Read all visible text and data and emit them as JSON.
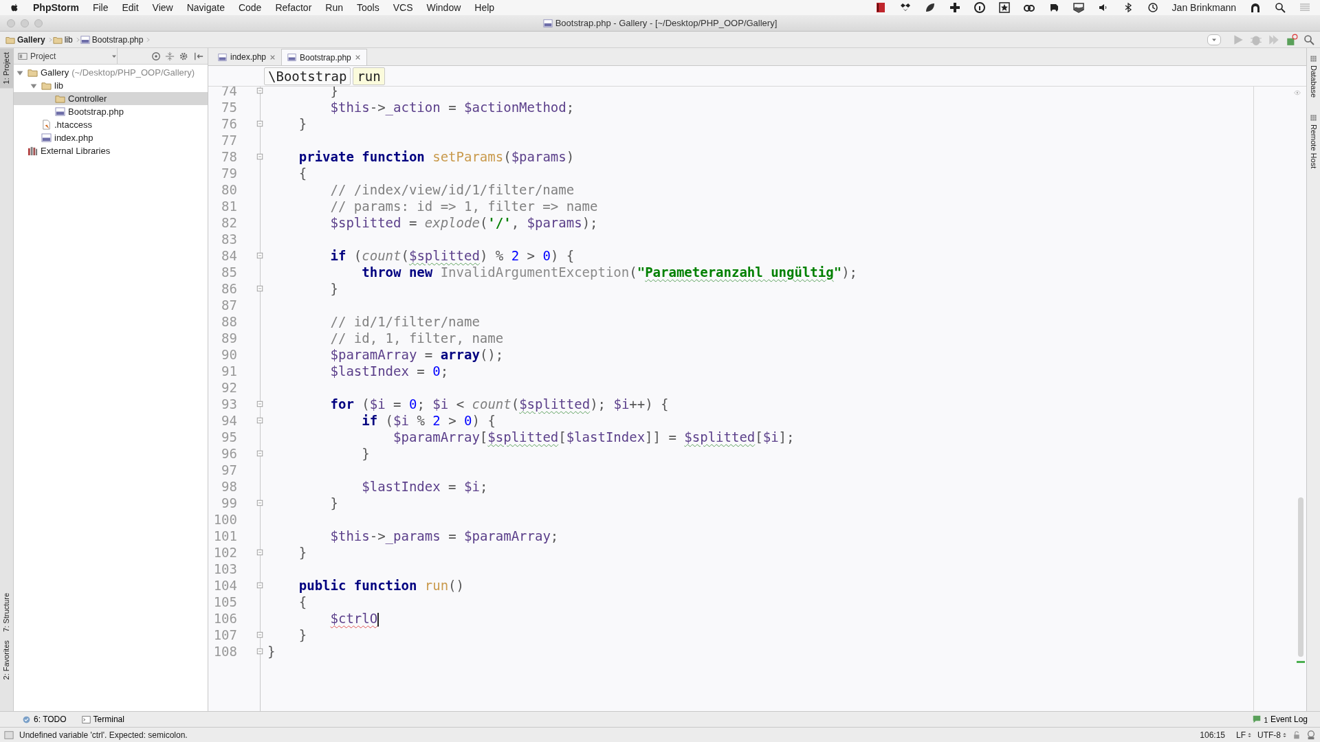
{
  "menubar": {
    "app": "PhpStorm",
    "menus": [
      "File",
      "Edit",
      "View",
      "Navigate",
      "Code",
      "Refactor",
      "Run",
      "Tools",
      "VCS",
      "Window",
      "Help"
    ],
    "user": "Jan Brinkmann"
  },
  "window": {
    "title": "Bootstrap.php - Gallery - [~/Desktop/PHP_OOP/Gallery]"
  },
  "breadcrumbs": [
    {
      "label": "Gallery",
      "kind": "folder"
    },
    {
      "label": "lib",
      "kind": "folder"
    },
    {
      "label": "Bootstrap.php",
      "kind": "php"
    }
  ],
  "left_strip": [
    {
      "label": "1: Project",
      "selected": true
    },
    {
      "label": "7: Structure",
      "selected": false
    },
    {
      "label": "2: Favorites",
      "selected": false
    }
  ],
  "project_panel": {
    "title": "Project",
    "tree": [
      {
        "label": "Gallery",
        "path": "(~/Desktop/PHP_OOP/Gallery)",
        "kind": "folder",
        "expanded": true,
        "selected": false,
        "children": [
          {
            "label": "lib",
            "kind": "folder",
            "expanded": true,
            "selected": false,
            "children": [
              {
                "label": "Controller",
                "kind": "folder",
                "selected": true
              },
              {
                "label": "Bootstrap.php",
                "kind": "php",
                "selected": false
              }
            ]
          },
          {
            "label": ".htaccess",
            "kind": "config",
            "selected": false
          },
          {
            "label": "index.php",
            "kind": "php",
            "selected": false
          }
        ]
      },
      {
        "label": "External Libraries",
        "kind": "library",
        "selected": false
      }
    ]
  },
  "tabs": [
    {
      "label": "index.php",
      "selected": false
    },
    {
      "label": "Bootstrap.php",
      "selected": true
    }
  ],
  "editor_breadcrumbs": [
    {
      "label": "\\Bootstrap",
      "selected": false
    },
    {
      "label": "run",
      "selected": true
    }
  ],
  "lines": [
    {
      "number": "74",
      "fold": true,
      "tokens": [
        {
          "kind": "pl",
          "text": "        }"
        }
      ]
    },
    {
      "number": "75",
      "fold": false,
      "tokens": [
        {
          "kind": "var",
          "text": "        $this"
        },
        {
          "kind": "pl",
          "text": "->"
        },
        {
          "kind": "var",
          "text": "_action"
        },
        {
          "kind": "pl",
          "text": " = "
        },
        {
          "kind": "var",
          "text": "$actionMethod"
        },
        {
          "kind": "pl",
          "text": ";"
        }
      ]
    },
    {
      "number": "76",
      "fold": true,
      "tokens": [
        {
          "kind": "pl",
          "text": "    }"
        }
      ]
    },
    {
      "number": "77",
      "fold": false
    },
    {
      "number": "78",
      "fold": true,
      "tokens": [
        {
          "kind": "kw",
          "text": "    private function "
        },
        {
          "kind": "fn",
          "text": "setParams"
        },
        {
          "kind": "pl",
          "text": "("
        },
        {
          "kind": "var",
          "text": "$params"
        },
        {
          "kind": "pl",
          "text": ")"
        }
      ]
    },
    {
      "number": "79",
      "fold": false,
      "tokens": [
        {
          "kind": "pl",
          "text": "    {"
        }
      ]
    },
    {
      "number": "80",
      "fold": false,
      "tokens": [
        {
          "kind": "cmt",
          "text": "        // /index/view/id/1/filter/name"
        }
      ]
    },
    {
      "number": "81",
      "fold": false,
      "tokens": [
        {
          "kind": "cmt",
          "text": "        // params: id => 1, filter => name"
        }
      ]
    },
    {
      "number": "82",
      "fold": false,
      "tokens": [
        {
          "kind": "var",
          "text": "        $splitted"
        },
        {
          "kind": "pl",
          "text": " = "
        },
        {
          "kind": "call",
          "text": "explode"
        },
        {
          "kind": "pl",
          "text": "("
        },
        {
          "kind": "str",
          "text": "'/'"
        },
        {
          "kind": "pl",
          "text": ", "
        },
        {
          "kind": "var",
          "text": "$params"
        },
        {
          "kind": "pl",
          "text": ");"
        }
      ]
    },
    {
      "number": "83",
      "fold": false
    },
    {
      "number": "84",
      "fold": true,
      "tokens": [
        {
          "kind": "kw",
          "text": "        if"
        },
        {
          "kind": "pl",
          "text": " ("
        },
        {
          "kind": "call",
          "text": "count"
        },
        {
          "kind": "pl",
          "text": "("
        },
        {
          "kind": "var",
          "text": "$splitted",
          "typo": true
        },
        {
          "kind": "pl",
          "text": ") % "
        },
        {
          "kind": "num",
          "text": "2"
        },
        {
          "kind": "pl",
          "text": " > "
        },
        {
          "kind": "num",
          "text": "0"
        },
        {
          "kind": "pl",
          "text": ") {"
        }
      ]
    },
    {
      "number": "85",
      "fold": false,
      "tokens": [
        {
          "kind": "kw",
          "text": "            throw new "
        },
        {
          "kind": "cls",
          "text": "InvalidArgumentException"
        },
        {
          "kind": "pl",
          "text": "("
        },
        {
          "kind": "str",
          "text": "\""
        },
        {
          "kind": "str",
          "text": "Parameteranzahl ungültig",
          "typo": true
        },
        {
          "kind": "str",
          "text": "\""
        },
        {
          "kind": "pl",
          "text": ");"
        }
      ]
    },
    {
      "number": "86",
      "fold": true,
      "tokens": [
        {
          "kind": "pl",
          "text": "        }"
        }
      ]
    },
    {
      "number": "87",
      "fold": false
    },
    {
      "number": "88",
      "fold": false,
      "tokens": [
        {
          "kind": "cmt",
          "text": "        // id/1/filter/name"
        }
      ]
    },
    {
      "number": "89",
      "fold": false,
      "tokens": [
        {
          "kind": "cmt",
          "text": "        // id, 1, filter, name"
        }
      ]
    },
    {
      "number": "90",
      "fold": false,
      "tokens": [
        {
          "kind": "var",
          "text": "        $paramArray"
        },
        {
          "kind": "pl",
          "text": " = "
        },
        {
          "kind": "kw",
          "text": "array"
        },
        {
          "kind": "pl",
          "text": "();"
        }
      ]
    },
    {
      "number": "91",
      "fold": false,
      "tokens": [
        {
          "kind": "var",
          "text": "        $lastIndex"
        },
        {
          "kind": "pl",
          "text": " = "
        },
        {
          "kind": "num",
          "text": "0"
        },
        {
          "kind": "pl",
          "text": ";"
        }
      ]
    },
    {
      "number": "92",
      "fold": false
    },
    {
      "number": "93",
      "fold": true,
      "tokens": [
        {
          "kind": "kw",
          "text": "        for"
        },
        {
          "kind": "pl",
          "text": " ("
        },
        {
          "kind": "var",
          "text": "$i"
        },
        {
          "kind": "pl",
          "text": " = "
        },
        {
          "kind": "num",
          "text": "0"
        },
        {
          "kind": "pl",
          "text": "; "
        },
        {
          "kind": "var",
          "text": "$i"
        },
        {
          "kind": "pl",
          "text": " < "
        },
        {
          "kind": "call",
          "text": "count"
        },
        {
          "kind": "pl",
          "text": "("
        },
        {
          "kind": "var",
          "text": "$splitted",
          "typo": true
        },
        {
          "kind": "pl",
          "text": "); "
        },
        {
          "kind": "var",
          "text": "$i"
        },
        {
          "kind": "pl",
          "text": "++) {"
        }
      ]
    },
    {
      "number": "94",
      "fold": true,
      "tokens": [
        {
          "kind": "kw",
          "text": "            if"
        },
        {
          "kind": "pl",
          "text": " ("
        },
        {
          "kind": "var",
          "text": "$i"
        },
        {
          "kind": "pl",
          "text": " % "
        },
        {
          "kind": "num",
          "text": "2"
        },
        {
          "kind": "pl",
          "text": " > "
        },
        {
          "kind": "num",
          "text": "0"
        },
        {
          "kind": "pl",
          "text": ") {"
        }
      ]
    },
    {
      "number": "95",
      "fold": false,
      "tokens": [
        {
          "kind": "var",
          "text": "                $paramArray"
        },
        {
          "kind": "pl",
          "text": "["
        },
        {
          "kind": "var",
          "text": "$splitted",
          "typo": true
        },
        {
          "kind": "pl",
          "text": "["
        },
        {
          "kind": "var",
          "text": "$lastIndex"
        },
        {
          "kind": "pl",
          "text": "]] = "
        },
        {
          "kind": "var",
          "text": "$splitted",
          "typo": true
        },
        {
          "kind": "pl",
          "text": "["
        },
        {
          "kind": "var",
          "text": "$i"
        },
        {
          "kind": "pl",
          "text": "];"
        }
      ]
    },
    {
      "number": "96",
      "fold": true,
      "tokens": [
        {
          "kind": "pl",
          "text": "            }"
        }
      ]
    },
    {
      "number": "97",
      "fold": false
    },
    {
      "number": "98",
      "fold": false,
      "tokens": [
        {
          "kind": "var",
          "text": "            $lastIndex"
        },
        {
          "kind": "pl",
          "text": " = "
        },
        {
          "kind": "var",
          "text": "$i"
        },
        {
          "kind": "pl",
          "text": ";"
        }
      ]
    },
    {
      "number": "99",
      "fold": true,
      "tokens": [
        {
          "kind": "pl",
          "text": "        }"
        }
      ]
    },
    {
      "number": "100",
      "fold": false
    },
    {
      "number": "101",
      "fold": false,
      "tokens": [
        {
          "kind": "var",
          "text": "        $this"
        },
        {
          "kind": "pl",
          "text": "->"
        },
        {
          "kind": "var",
          "text": "_params"
        },
        {
          "kind": "pl",
          "text": " = "
        },
        {
          "kind": "var",
          "text": "$paramArray"
        },
        {
          "kind": "pl",
          "text": ";"
        }
      ]
    },
    {
      "number": "102",
      "fold": true,
      "tokens": [
        {
          "kind": "pl",
          "text": "    }"
        }
      ]
    },
    {
      "number": "103",
      "fold": false
    },
    {
      "number": "104",
      "fold": true,
      "tokens": [
        {
          "kind": "kw",
          "text": "    public function "
        },
        {
          "kind": "fn",
          "text": "run"
        },
        {
          "kind": "pl",
          "text": "()"
        }
      ]
    },
    {
      "number": "105",
      "fold": false,
      "tokens": [
        {
          "kind": "pl",
          "text": "    {"
        }
      ]
    },
    {
      "number": "106",
      "fold": false,
      "caret": true,
      "tokens": [
        {
          "kind": "var",
          "text": "        $ctrlO",
          "error": true
        }
      ]
    },
    {
      "number": "107",
      "fold": true,
      "tokens": [
        {
          "kind": "pl",
          "text": "    }"
        }
      ]
    },
    {
      "number": "108",
      "fold": true,
      "tokens": [
        {
          "kind": "pl",
          "text": "}"
        }
      ]
    }
  ],
  "bottom_tools": [
    {
      "label": "6: TODO",
      "kind": "todo"
    },
    {
      "label": "Terminal",
      "kind": "terminal"
    }
  ],
  "event_log": {
    "count": "1",
    "label": "Event Log"
  },
  "status_bar": {
    "message": "Undefined variable 'ctrl'. Expected: semicolon.",
    "position": "106:15",
    "line_ending": "LF",
    "encoding": "UTF-8"
  },
  "right_strip": [
    {
      "label": "Database"
    },
    {
      "label": "Remote Host"
    }
  ]
}
